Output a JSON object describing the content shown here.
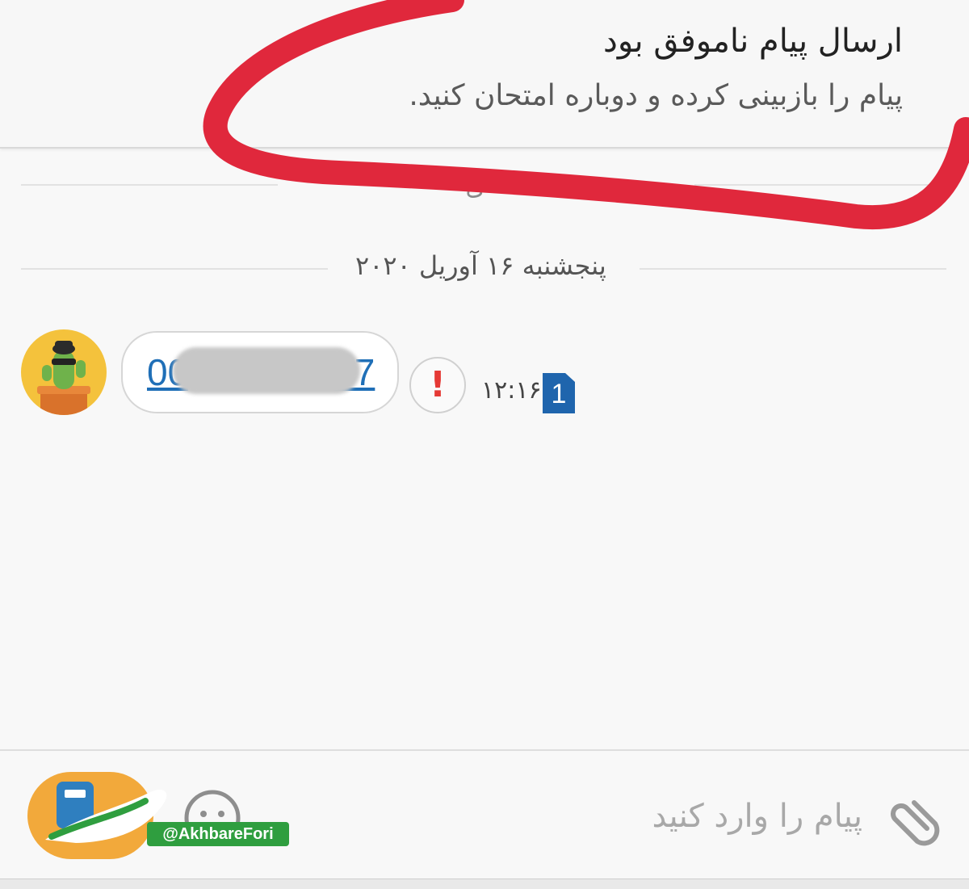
{
  "banner": {
    "title": "ارسال پیام ناموفق بود",
    "subtitle": "پیام را بازبینی کرده و دوباره امتحان کنید."
  },
  "thread": {
    "old_label": "ی",
    "date": "پنجشنبه ۱۶ آوریل ۲۰۲۰",
    "message": {
      "text": "00",
      "tail": "77",
      "time": "۱۲:۱۶",
      "sim": "1",
      "error_icon": "!"
    }
  },
  "composer": {
    "placeholder": "پیام را وارد کنید"
  },
  "watermark": {
    "handle": "@AkhbareFori"
  },
  "colors": {
    "annotation_red": "#e0283c",
    "link_blue": "#1f6fb7",
    "error_red": "#e53935",
    "sim_blue": "#1f65ad",
    "avatar_yellow": "#f4c23c",
    "watermark_orange": "#f2a93b",
    "watermark_green": "#2f9e3f"
  }
}
